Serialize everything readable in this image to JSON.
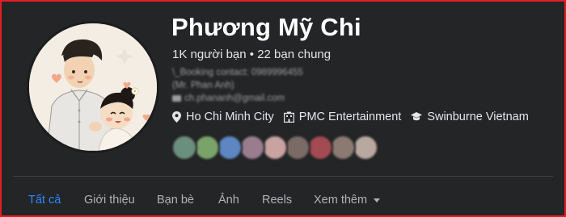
{
  "profile": {
    "name": "Phương Mỹ Chi",
    "friends_line": "1K người bạn • 22 bạn chung",
    "bio_lines": [
      "\\_Booking contact: 0989996455",
      "(Mr. Phan Anh)",
      "ch.phananh@gmail.com"
    ]
  },
  "info": {
    "location": "Ho Chi Minh City",
    "work": "PMC Entertainment",
    "education": "Swinburne Vietnam"
  },
  "mutual_friend_colors": [
    "#6b8f7e",
    "#7aa36a",
    "#5d86c2",
    "#9a7c8f",
    "#c9a3a0",
    "#7a6b66",
    "#a34a52",
    "#8b7a72",
    "#b8a8a0"
  ],
  "tabs": [
    {
      "label": "Tất cả",
      "active": true
    },
    {
      "label": "Giới thiệu"
    },
    {
      "label": "Bạn bè"
    },
    {
      "label": "Ảnh"
    },
    {
      "label": "Reels"
    },
    {
      "label": "Xem thêm"
    }
  ],
  "colors": {
    "accent": "#2d88ff",
    "background": "#242526",
    "frame_border": "#e41e26"
  }
}
